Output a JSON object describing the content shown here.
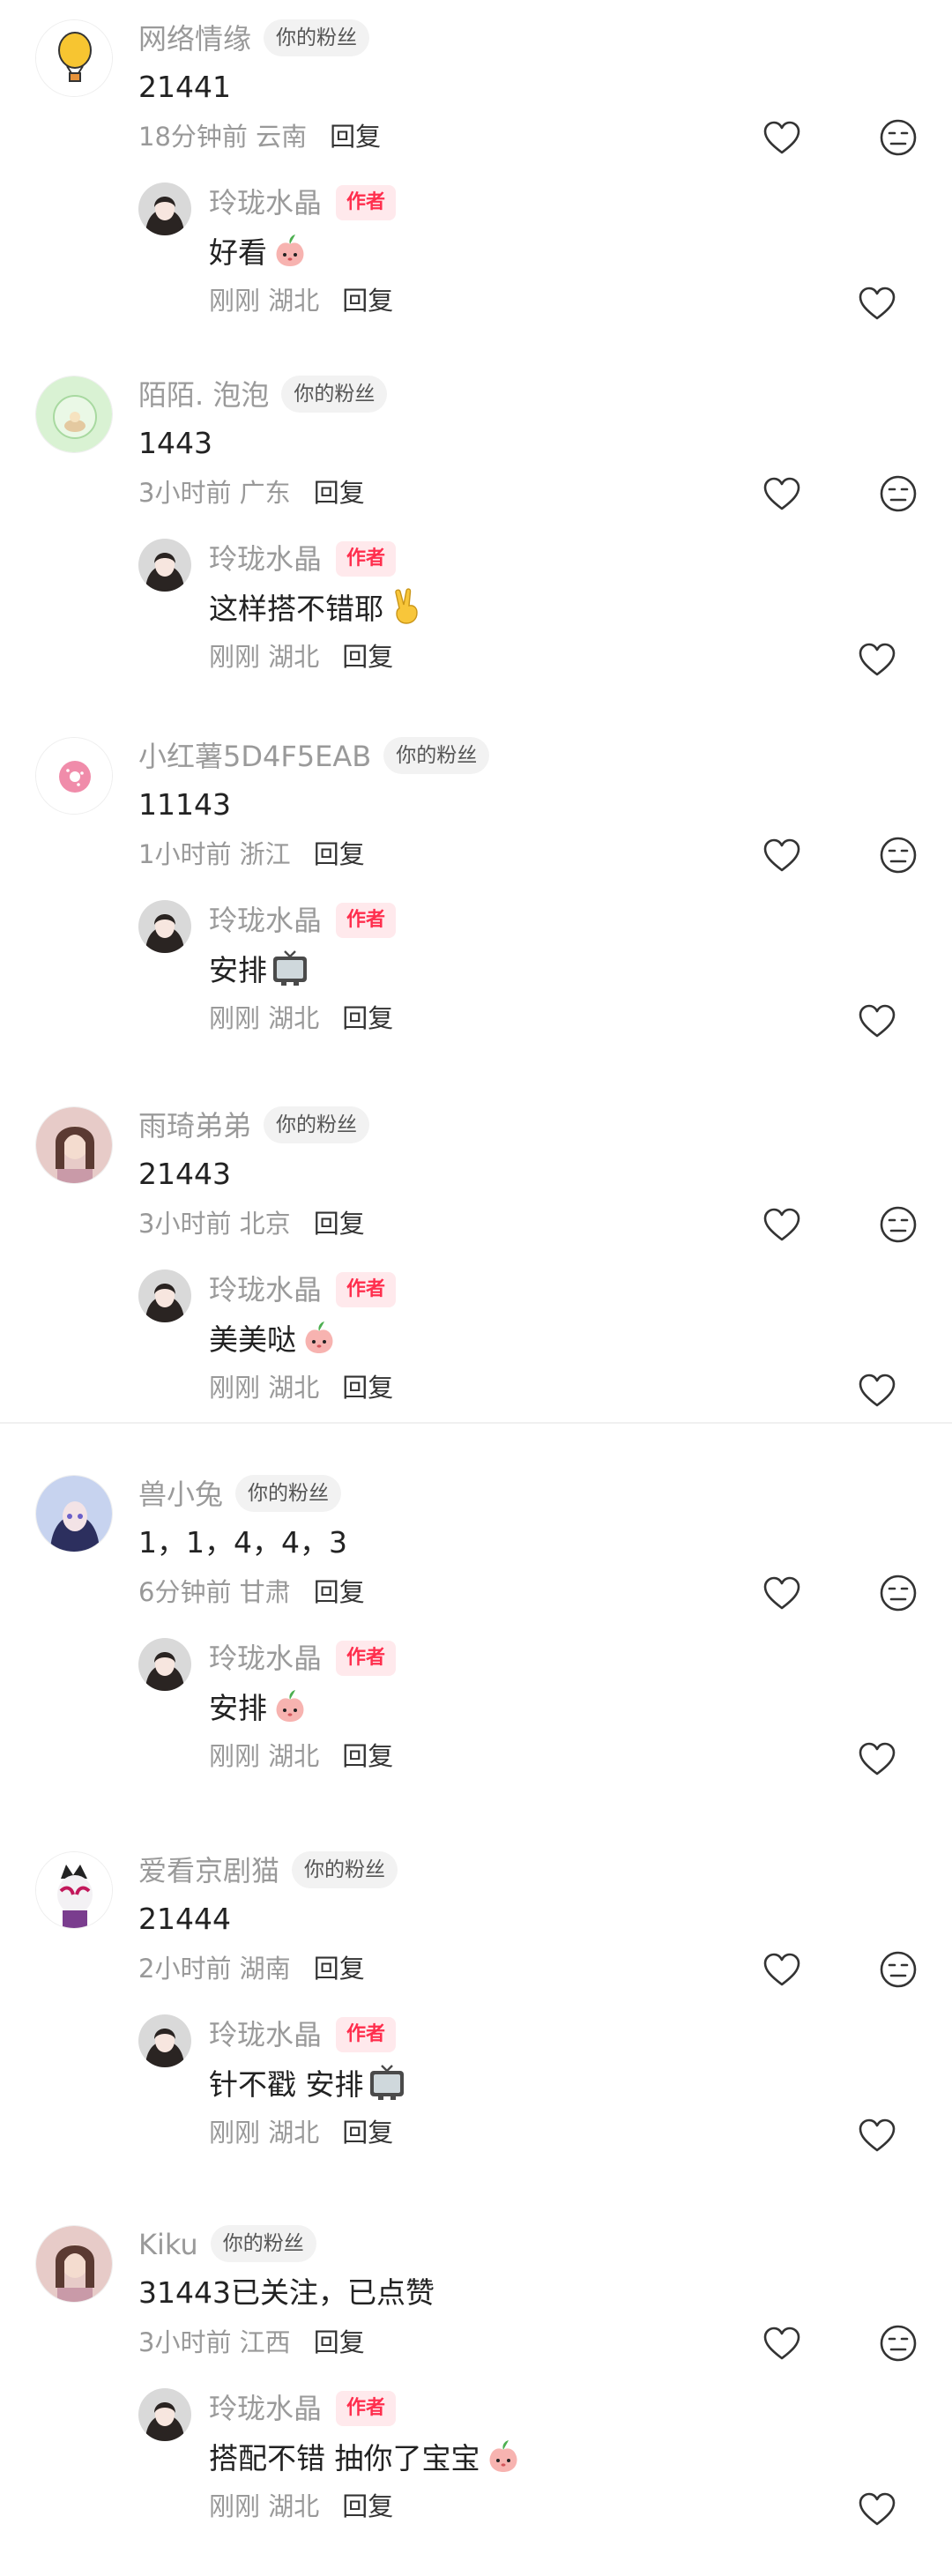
{
  "labels": {
    "fan_badge": "你的粉丝",
    "author_badge": "作者",
    "reply": "回复"
  },
  "comments": [
    {
      "user": "网络情缘",
      "text": "21441",
      "time": "18分钟前",
      "location": "云南",
      "avatar_icon": "hot-air-balloon-icon",
      "reply": {
        "user": "玲珑水晶",
        "text": "好看",
        "emoji": "peach-face-emoji",
        "time": "刚刚",
        "location": "湖北"
      }
    },
    {
      "user": "陌陌. 泡泡",
      "text": "1443",
      "time": "3小时前",
      "location": "广东",
      "avatar_icon": "fishbowl-cat-icon",
      "reply": {
        "user": "玲珑水晶",
        "text": "这样搭不错耶",
        "emoji": "victory-hand-emoji",
        "time": "刚刚",
        "location": "湖北"
      }
    },
    {
      "user": "小红薯5D4F5EAB",
      "text": "11143",
      "time": "1小时前",
      "location": "浙江",
      "avatar_icon": "donut-icon",
      "reply": {
        "user": "玲珑水晶",
        "text": "安排",
        "emoji": "tv-emoji",
        "time": "刚刚",
        "location": "湖北"
      }
    },
    {
      "user": "雨琦弟弟",
      "text": "21443",
      "time": "3小时前",
      "location": "北京",
      "avatar_icon": "portrait-photo-icon",
      "reply": {
        "user": "玲珑水晶",
        "text": "美美哒",
        "emoji": "peach-face-emoji",
        "time": "刚刚",
        "location": "湖北"
      }
    },
    {
      "user": "兽小兔",
      "text": "1，1，4，4，3",
      "time": "6分钟前",
      "location": "甘肃",
      "avatar_icon": "anime-girl-icon",
      "reply": {
        "user": "玲珑水晶",
        "text": "安排",
        "emoji": "peach-face-emoji",
        "time": "刚刚",
        "location": "湖北"
      }
    },
    {
      "user": "爱看京剧猫",
      "text": "21444",
      "time": "2小时前",
      "location": "湖南",
      "avatar_icon": "opera-cat-icon",
      "reply": {
        "user": "玲珑水晶",
        "text": "针不戳 安排",
        "emoji": "tv-emoji",
        "time": "刚刚",
        "location": "湖北"
      }
    },
    {
      "user": "Kiku",
      "text": "31443已关注，已点赞",
      "time": "3小时前",
      "location": "江西",
      "avatar_icon": "portrait-photo-icon",
      "reply": {
        "user": "玲珑水晶",
        "text": "搭配不错 抽你了宝宝",
        "emoji": "peach-face-emoji",
        "time": "刚刚",
        "location": "湖北"
      }
    }
  ]
}
